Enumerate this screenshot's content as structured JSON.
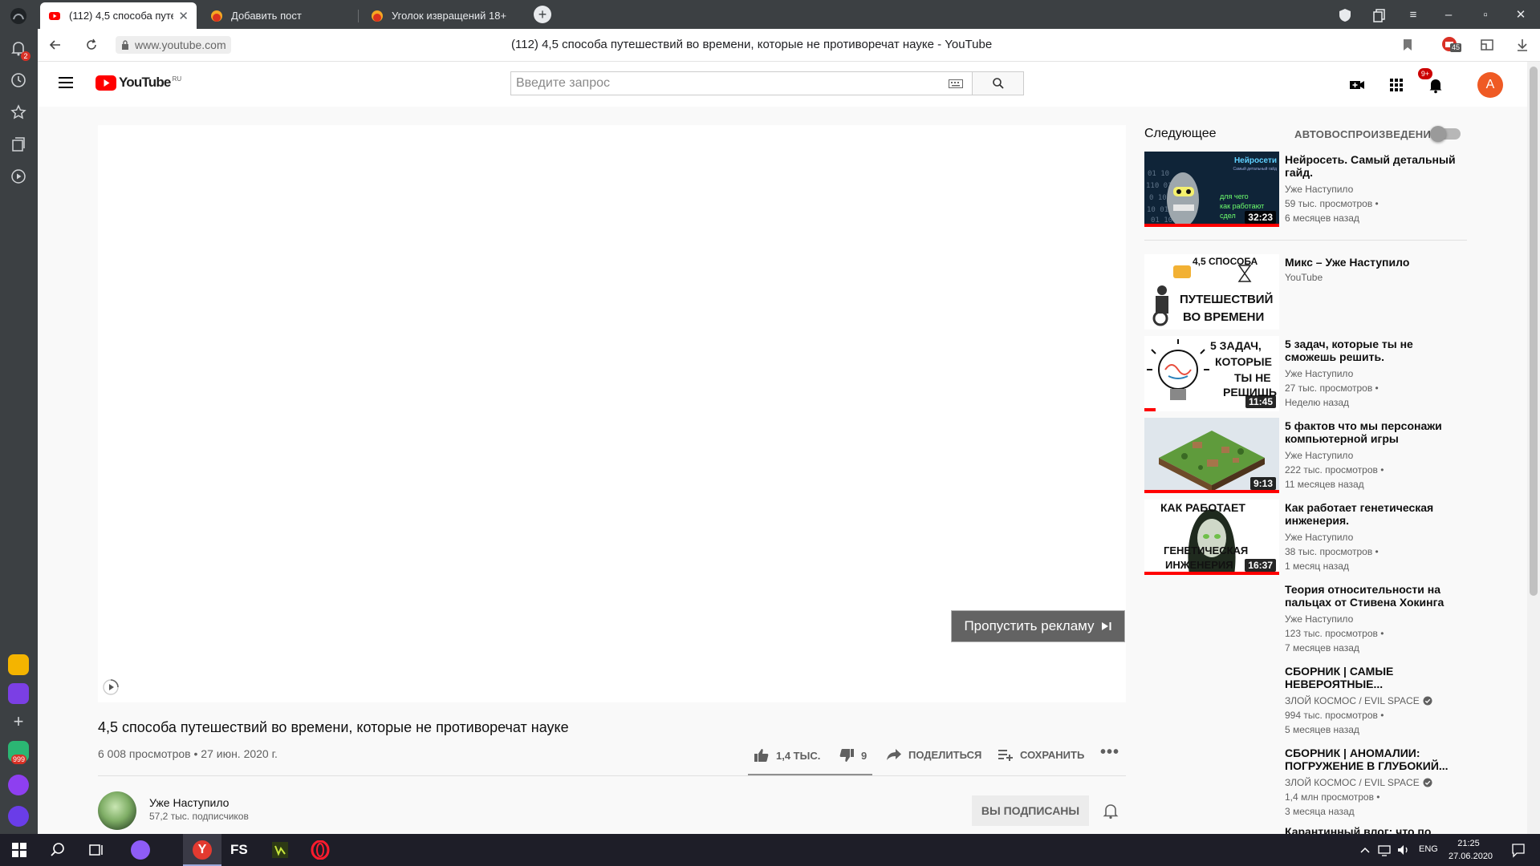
{
  "browser": {
    "tabs": [
      {
        "title": "(112) 4,5 способа путеш",
        "active": true
      },
      {
        "title": "Добавить пост",
        "active": false
      },
      {
        "title": "Уголок извращений 18+",
        "active": false
      }
    ],
    "url": "www.youtube.com",
    "page_title": "(112) 4,5 способа путешествий во времени, которые не противоречат науке - YouTube",
    "sidebar_badge": "2",
    "app_badge": "999",
    "extension_badge": "45"
  },
  "youtube": {
    "logo_text": "YouTube",
    "logo_region": "RU",
    "search_placeholder": "Введите запрос",
    "notifications_badge": "9+",
    "avatar_letter": "A",
    "brand_red": "#ff0000"
  },
  "player": {
    "skip_ad_label": "Пропустить рекламу"
  },
  "video": {
    "title": "4,5 способа путешествий во времени, которые не противоречат науке",
    "meta": "6 008 просмотров • 27 июн. 2020 г.",
    "likes": "1,4 ТЫС.",
    "dislikes": "9",
    "share_label": "ПОДЕЛИТЬСЯ",
    "save_label": "СОХРАНИТЬ",
    "channel_name": "Уже Наступило",
    "channel_subs": "57,2 тыс. подписчиков",
    "subscribed_label": "ВЫ ПОДПИСАНЫ"
  },
  "sidebar": {
    "up_next_label": "Следующее",
    "autoplay_label": "АВТОВОСПРОИЗВЕДЕНИЕ",
    "autoplay_on": false,
    "items": [
      {
        "title": "Нейросеть. Самый детальный гайд.",
        "channel": "Уже Наступило",
        "views": "59 тыс. просмотров •",
        "date": "6 месяцев назад",
        "duration": "32:23",
        "thumb_text": "Нейросети",
        "thumb_sub": "Самый детальный гайд",
        "thumb_text2": "для чего\nкак работают\nсдел",
        "progress": 1.0
      },
      {
        "title": "Микс – Уже Наступило",
        "channel": "YouTube",
        "thumb_text": "4,5 СПОСОБА",
        "thumb_text2": "ПУТЕШЕСТВИЙ",
        "thumb_text3": "ВО ВРЕМЕНИ"
      },
      {
        "title": "5 задач, которые ты не сможешь решить.",
        "channel": "Уже Наступило",
        "views": "27 тыс. просмотров •",
        "date": "Неделю назад",
        "duration": "11:45",
        "thumb_text": "5 ЗАДАЧ,",
        "thumb_text2": "КОТОРЫЕ",
        "thumb_text3": "ТЫ НЕ",
        "thumb_text4": "РЕШИШЬ",
        "progress": 0.08
      },
      {
        "title": "5 фактов что мы персонажи компьютерной игры",
        "channel": "Уже Наступило",
        "views": "222 тыс. просмотров •",
        "date": "11 месяцев назад",
        "duration": "9:13",
        "progress": 1.0
      },
      {
        "title": "Как работает генетическая инженерия.",
        "channel": "Уже Наступило",
        "views": "38 тыс. просмотров •",
        "date": "1 месяц назад",
        "duration": "16:37",
        "thumb_text": "КАК РАБОТАЕТ",
        "thumb_text2": "ГЕНЕТИЧЕСКАЯ",
        "thumb_text3": "ИНЖЕНЕРИЯ",
        "progress": 1.0
      },
      {
        "title": "Теория относительности на пальцах от Стивена Хокинга",
        "channel": "Уже Наступило",
        "views": "123 тыс. просмотров •",
        "date": "7 месяцев назад"
      },
      {
        "title": "СБОРНИК | САМЫЕ НЕВЕРОЯТНЫЕ...",
        "channel": "ЗЛОЙ КОСМОС / EVIL SPACE",
        "views": "994 тыс. просмотров •",
        "date": "5 месяцев назад",
        "verified": true
      },
      {
        "title": "СБОРНИК | АНОМАЛИИ: ПОГРУЖЕНИЕ В ГЛУБОКИЙ...",
        "channel": "ЗЛОЙ КОСМОС / EVIL SPACE",
        "views": "1,4 млн просмотров •",
        "date": "3 месяца назад",
        "verified": true
      },
      {
        "title": "Карантинный влог: что по"
      }
    ]
  },
  "taskbar": {
    "lang": "ENG",
    "time": "21:25",
    "date": "27.06.2020",
    "fs_label": "FS"
  }
}
